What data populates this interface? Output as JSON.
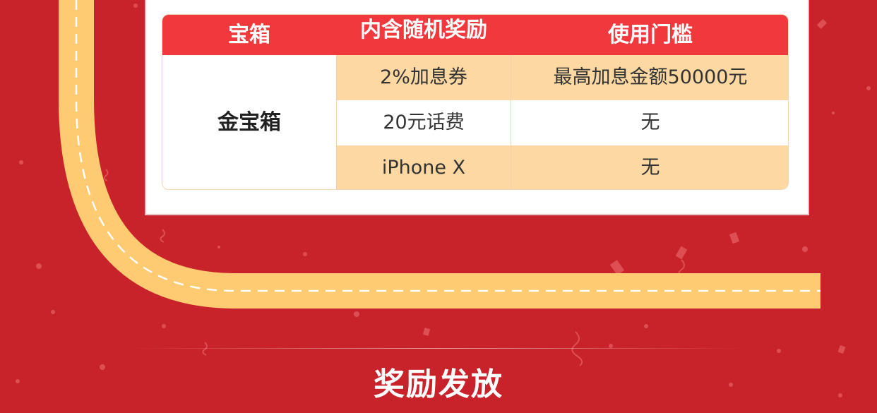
{
  "table": {
    "headers": [
      "宝箱",
      "内含随机奖励",
      "使用门槛"
    ],
    "chest_name": "金宝箱",
    "rows": [
      {
        "reward": "2%加息券",
        "threshold": "最高加息金额50000元"
      },
      {
        "reward": "20元话费",
        "threshold": "无"
      },
      {
        "reward": "iPhone X",
        "threshold": "无"
      }
    ]
  },
  "footer": {
    "title": "奖励发放"
  },
  "colors": {
    "background": "#c8232a",
    "header": "#f1393d",
    "row_peach": "#fdd8a2",
    "road": "#fecb73"
  }
}
